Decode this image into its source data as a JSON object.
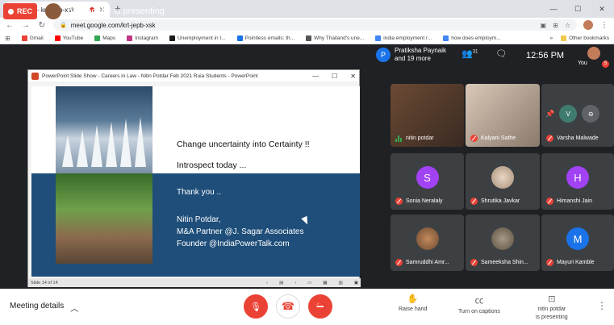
{
  "browser": {
    "tab_title": "Meet - krt-jepb-xsk",
    "new_tab": "+",
    "url": "meet.google.com/krt-jepb-xsk",
    "window_controls": [
      "—",
      "☐",
      "✕"
    ],
    "bookmarks": [
      {
        "label": "Gmail",
        "color": "#ea4335"
      },
      {
        "label": "YouTube",
        "color": "#ff0000"
      },
      {
        "label": "Maps",
        "color": "#34a853"
      },
      {
        "label": "Instagram",
        "color": "#c13584"
      },
      {
        "label": "Unemployment in I...",
        "color": "#1a1a1a"
      },
      {
        "label": "Pointless emails: th...",
        "color": "#1a73e8"
      },
      {
        "label": "Why Thailand's une...",
        "color": "#555555"
      },
      {
        "label": "india employment r...",
        "color": "#4285f4"
      },
      {
        "label": "how does employm...",
        "color": "#4285f4"
      }
    ],
    "bookmarks_more": "»",
    "other_bookmarks": "Other bookmarks"
  },
  "meet": {
    "rec_label": "REC",
    "presenting_text": "nitin potdar is presenting",
    "participants_summary": "Pratiksha Paynaik and 19 more",
    "participants_initial": "P",
    "participant_count": "31",
    "time": "12:56 PM",
    "you_label": "You",
    "you_badge": "5"
  },
  "powerpoint": {
    "window_title": "PowerPoint Slide Show - Careers in Law - Nitin Potdar Feb 2021 Ruia Students - PowerPoint",
    "slide_line1": "Change uncertainty into Certainty !!",
    "slide_line2": "Introspect today ...",
    "thank_you": "Thank you ..",
    "sig_name": "Nitin Potdar,",
    "sig_role": "M&A Partner @J. Sagar Associates",
    "sig_founder": "Founder @IndiaPowerTalk.com",
    "slide_counter": "Slide 14 of 14"
  },
  "participants": [
    {
      "name": "nitin potdar",
      "type": "video",
      "speaking": true
    },
    {
      "name": "Kalyani Sathe",
      "type": "video"
    },
    {
      "name": "Varsha Malwade",
      "type": "video"
    },
    {
      "name": "Sonia Neralaly",
      "type": "initial",
      "initial": "S",
      "color": "#a142f4"
    },
    {
      "name": "Shrutika Javkar",
      "type": "photo",
      "color": "#c7a88f"
    },
    {
      "name": "Himanshi Jain",
      "type": "initial",
      "initial": "H",
      "color": "#a142f4"
    },
    {
      "name": "Samruddhi Amr...",
      "type": "photo",
      "color": "#8b5a3c"
    },
    {
      "name": "Sameeksha Shin...",
      "type": "photo",
      "color": "#6b5e4e"
    },
    {
      "name": "Mayuri Kamble",
      "type": "initial",
      "initial": "M",
      "color": "#1a73e8"
    }
  ],
  "bottom": {
    "meeting_details": "Meeting details",
    "raise_hand": "Raise hand",
    "captions": "Turn on captions",
    "presenting_line1": "nitin potdar",
    "presenting_line2": "is presenting"
  }
}
